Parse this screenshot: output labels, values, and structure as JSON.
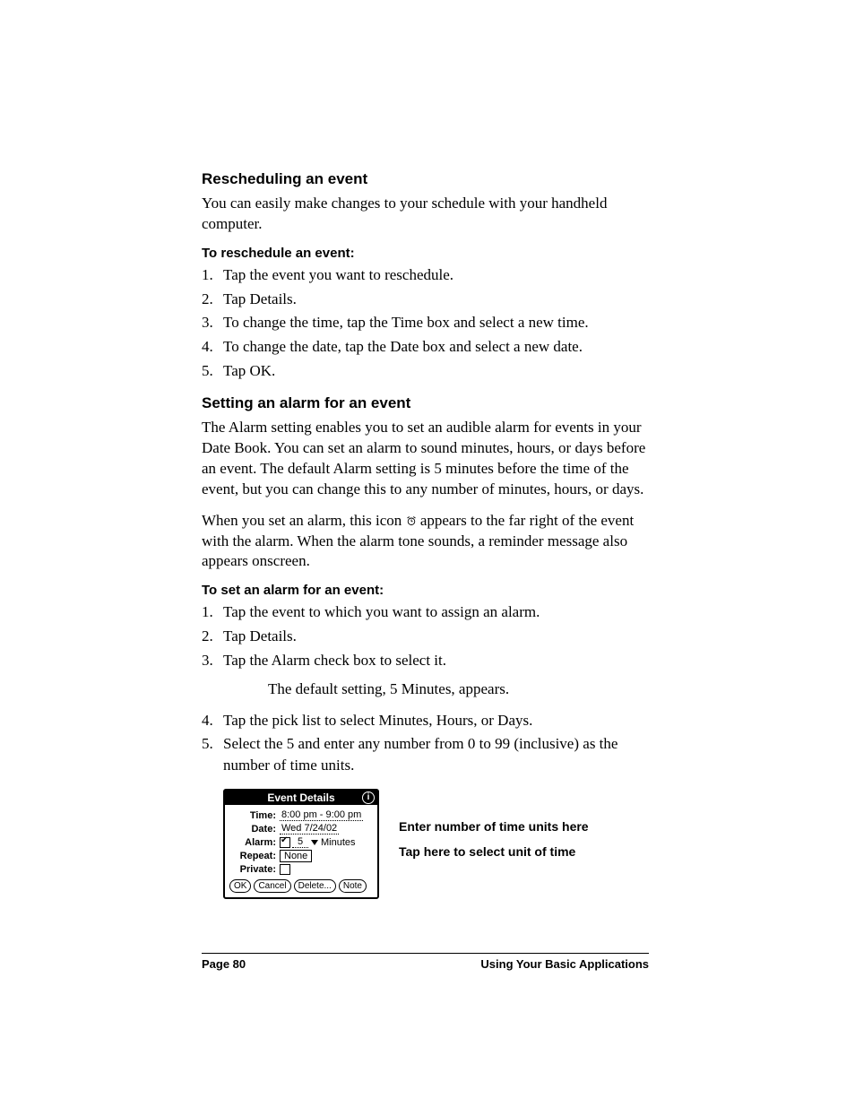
{
  "section1": {
    "heading": "Rescheduling an event",
    "intro": "You can easily make changes to your schedule with your handheld computer.",
    "sub": "To reschedule an event:",
    "steps": [
      "Tap the event you want to reschedule.",
      "Tap Details.",
      "To change the time, tap the Time box and select a new time.",
      "To change the date, tap the Date box and select a new date.",
      "Tap OK."
    ]
  },
  "section2": {
    "heading": "Setting an alarm for an event",
    "p1": "The Alarm setting enables you to set an audible alarm for events in your Date Book. You can set an alarm to sound minutes, hours, or days before an event. The default Alarm setting is 5 minutes before the time of the event, but you can change this to any number of minutes, hours, or days.",
    "p2a": "When you set an alarm, this icon ",
    "p2b": " appears to the far right of the event with the alarm. When the alarm tone sounds, a reminder message also appears onscreen.",
    "sub": "To set an alarm for an event:",
    "steps": [
      "Tap the event to which you want to assign an alarm.",
      "Tap Details.",
      "Tap the Alarm check box to select it.",
      "Tap the pick list to select Minutes, Hours, or Days.",
      "Select the 5 and enter any number from 0 to 99 (inclusive) as the number of time units."
    ],
    "step3_note": "The default setting, 5 Minutes, appears."
  },
  "dialog": {
    "title": "Event Details",
    "info_icon": "i",
    "labels": {
      "time": "Time:",
      "date": "Date:",
      "alarm": "Alarm:",
      "repeat": "Repeat:",
      "private": "Private:"
    },
    "values": {
      "time": "8:00 pm - 9:00 pm",
      "date": "Wed 7/24/02",
      "alarm_num": "5",
      "alarm_unit": "Minutes",
      "repeat": "None"
    },
    "buttons": [
      "OK",
      "Cancel",
      "Delete...",
      "Note"
    ]
  },
  "callouts": {
    "c1": "Enter number of time units here",
    "c2": "Tap here to select unit of time"
  },
  "footer": {
    "left": "Page 80",
    "right": "Using Your Basic Applications"
  }
}
